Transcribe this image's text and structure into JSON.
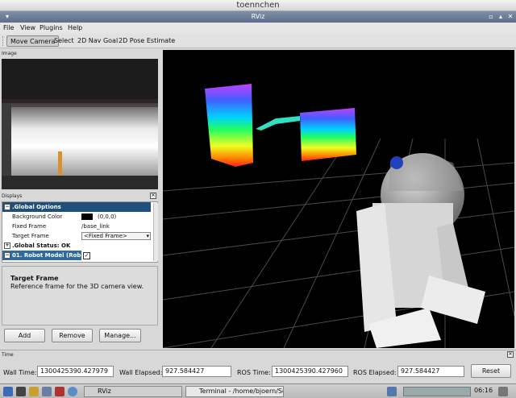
{
  "window": {
    "host_title": "toennchen",
    "app_title": "RViz"
  },
  "menu": [
    "File",
    "View",
    "Plugins",
    "Help"
  ],
  "toolbar": {
    "tools": [
      "Move Camera",
      "Select",
      "2D Nav Goal",
      "2D Pose Estimate"
    ],
    "active": "Move Camera"
  },
  "image_panel": {
    "title": "Image"
  },
  "displays": {
    "title": "Displays",
    "rows": [
      {
        "label": ".Global Options"
      },
      {
        "label": "Background Color",
        "value": "(0,0,0)"
      },
      {
        "label": "Fixed Frame",
        "value": "/base_link"
      },
      {
        "label": "Target Frame",
        "value": "<Fixed Frame>"
      },
      {
        "label": ".Global Status: OK"
      },
      {
        "label": "01. Robot Model (Rob"
      }
    ],
    "background_color": "#000000"
  },
  "help": {
    "title": "Target Frame",
    "text": "Reference frame for the 3D camera view."
  },
  "buttons": {
    "add": "Add",
    "remove": "Remove",
    "manage": "Manage..."
  },
  "time": {
    "title": "Time",
    "wall_time_label": "Wall Time:",
    "wall_time": "1300425390.427979",
    "wall_elapsed_label": "Wall Elapsed:",
    "wall_elapsed": "927.584427",
    "ros_time_label": "ROS Time:",
    "ros_time": "1300425390.427960",
    "ros_elapsed_label": "ROS Elapsed:",
    "ros_elapsed": "927.584427",
    "reset": "Reset"
  },
  "taskbar": {
    "tasks": [
      "RViz",
      "Terminal - /home/bjoern/So..."
    ],
    "clock": "06:16"
  },
  "colors": {
    "title_blue": "#1f4f7c",
    "selected_blue": "#2f6aa0"
  }
}
